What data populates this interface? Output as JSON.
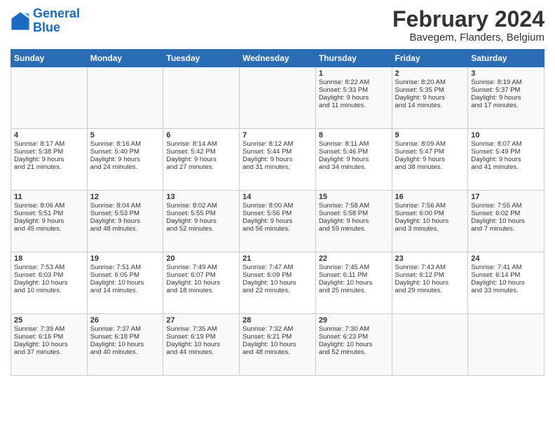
{
  "header": {
    "logo_line1": "General",
    "logo_line2": "Blue",
    "month_title": "February 2024",
    "location": "Bavegem, Flanders, Belgium"
  },
  "days_of_week": [
    "Sunday",
    "Monday",
    "Tuesday",
    "Wednesday",
    "Thursday",
    "Friday",
    "Saturday"
  ],
  "weeks": [
    [
      {
        "day": "",
        "text": ""
      },
      {
        "day": "",
        "text": ""
      },
      {
        "day": "",
        "text": ""
      },
      {
        "day": "",
        "text": ""
      },
      {
        "day": "1",
        "text": "Sunrise: 8:22 AM\nSunset: 5:33 PM\nDaylight: 9 hours\nand 11 minutes."
      },
      {
        "day": "2",
        "text": "Sunrise: 8:20 AM\nSunset: 5:35 PM\nDaylight: 9 hours\nand 14 minutes."
      },
      {
        "day": "3",
        "text": "Sunrise: 8:19 AM\nSunset: 5:37 PM\nDaylight: 9 hours\nand 17 minutes."
      }
    ],
    [
      {
        "day": "4",
        "text": "Sunrise: 8:17 AM\nSunset: 5:38 PM\nDaylight: 9 hours\nand 21 minutes."
      },
      {
        "day": "5",
        "text": "Sunrise: 8:16 AM\nSunset: 5:40 PM\nDaylight: 9 hours\nand 24 minutes."
      },
      {
        "day": "6",
        "text": "Sunrise: 8:14 AM\nSunset: 5:42 PM\nDaylight: 9 hours\nand 27 minutes."
      },
      {
        "day": "7",
        "text": "Sunrise: 8:12 AM\nSunset: 5:44 PM\nDaylight: 9 hours\nand 31 minutes."
      },
      {
        "day": "8",
        "text": "Sunrise: 8:11 AM\nSunset: 5:46 PM\nDaylight: 9 hours\nand 34 minutes."
      },
      {
        "day": "9",
        "text": "Sunrise: 8:09 AM\nSunset: 5:47 PM\nDaylight: 9 hours\nand 38 minutes."
      },
      {
        "day": "10",
        "text": "Sunrise: 8:07 AM\nSunset: 5:49 PM\nDaylight: 9 hours\nand 41 minutes."
      }
    ],
    [
      {
        "day": "11",
        "text": "Sunrise: 8:06 AM\nSunset: 5:51 PM\nDaylight: 9 hours\nand 45 minutes."
      },
      {
        "day": "12",
        "text": "Sunrise: 8:04 AM\nSunset: 5:53 PM\nDaylight: 9 hours\nand 48 minutes."
      },
      {
        "day": "13",
        "text": "Sunrise: 8:02 AM\nSunset: 5:55 PM\nDaylight: 9 hours\nand 52 minutes."
      },
      {
        "day": "14",
        "text": "Sunrise: 8:00 AM\nSunset: 5:56 PM\nDaylight: 9 hours\nand 56 minutes."
      },
      {
        "day": "15",
        "text": "Sunrise: 7:58 AM\nSunset: 5:58 PM\nDaylight: 9 hours\nand 59 minutes."
      },
      {
        "day": "16",
        "text": "Sunrise: 7:56 AM\nSunset: 6:00 PM\nDaylight: 10 hours\nand 3 minutes."
      },
      {
        "day": "17",
        "text": "Sunrise: 7:55 AM\nSunset: 6:02 PM\nDaylight: 10 hours\nand 7 minutes."
      }
    ],
    [
      {
        "day": "18",
        "text": "Sunrise: 7:53 AM\nSunset: 6:03 PM\nDaylight: 10 hours\nand 10 minutes."
      },
      {
        "day": "19",
        "text": "Sunrise: 7:51 AM\nSunset: 6:05 PM\nDaylight: 10 hours\nand 14 minutes."
      },
      {
        "day": "20",
        "text": "Sunrise: 7:49 AM\nSunset: 6:07 PM\nDaylight: 10 hours\nand 18 minutes."
      },
      {
        "day": "21",
        "text": "Sunrise: 7:47 AM\nSunset: 6:09 PM\nDaylight: 10 hours\nand 22 minutes."
      },
      {
        "day": "22",
        "text": "Sunrise: 7:45 AM\nSunset: 6:11 PM\nDaylight: 10 hours\nand 25 minutes."
      },
      {
        "day": "23",
        "text": "Sunrise: 7:43 AM\nSunset: 6:12 PM\nDaylight: 10 hours\nand 29 minutes."
      },
      {
        "day": "24",
        "text": "Sunrise: 7:41 AM\nSunset: 6:14 PM\nDaylight: 10 hours\nand 33 minutes."
      }
    ],
    [
      {
        "day": "25",
        "text": "Sunrise: 7:39 AM\nSunset: 6:16 PM\nDaylight: 10 hours\nand 37 minutes."
      },
      {
        "day": "26",
        "text": "Sunrise: 7:37 AM\nSunset: 6:18 PM\nDaylight: 10 hours\nand 40 minutes."
      },
      {
        "day": "27",
        "text": "Sunrise: 7:35 AM\nSunset: 6:19 PM\nDaylight: 10 hours\nand 44 minutes."
      },
      {
        "day": "28",
        "text": "Sunrise: 7:32 AM\nSunset: 6:21 PM\nDaylight: 10 hours\nand 48 minutes."
      },
      {
        "day": "29",
        "text": "Sunrise: 7:30 AM\nSunset: 6:23 PM\nDaylight: 10 hours\nand 52 minutes."
      },
      {
        "day": "",
        "text": ""
      },
      {
        "day": "",
        "text": ""
      }
    ]
  ]
}
